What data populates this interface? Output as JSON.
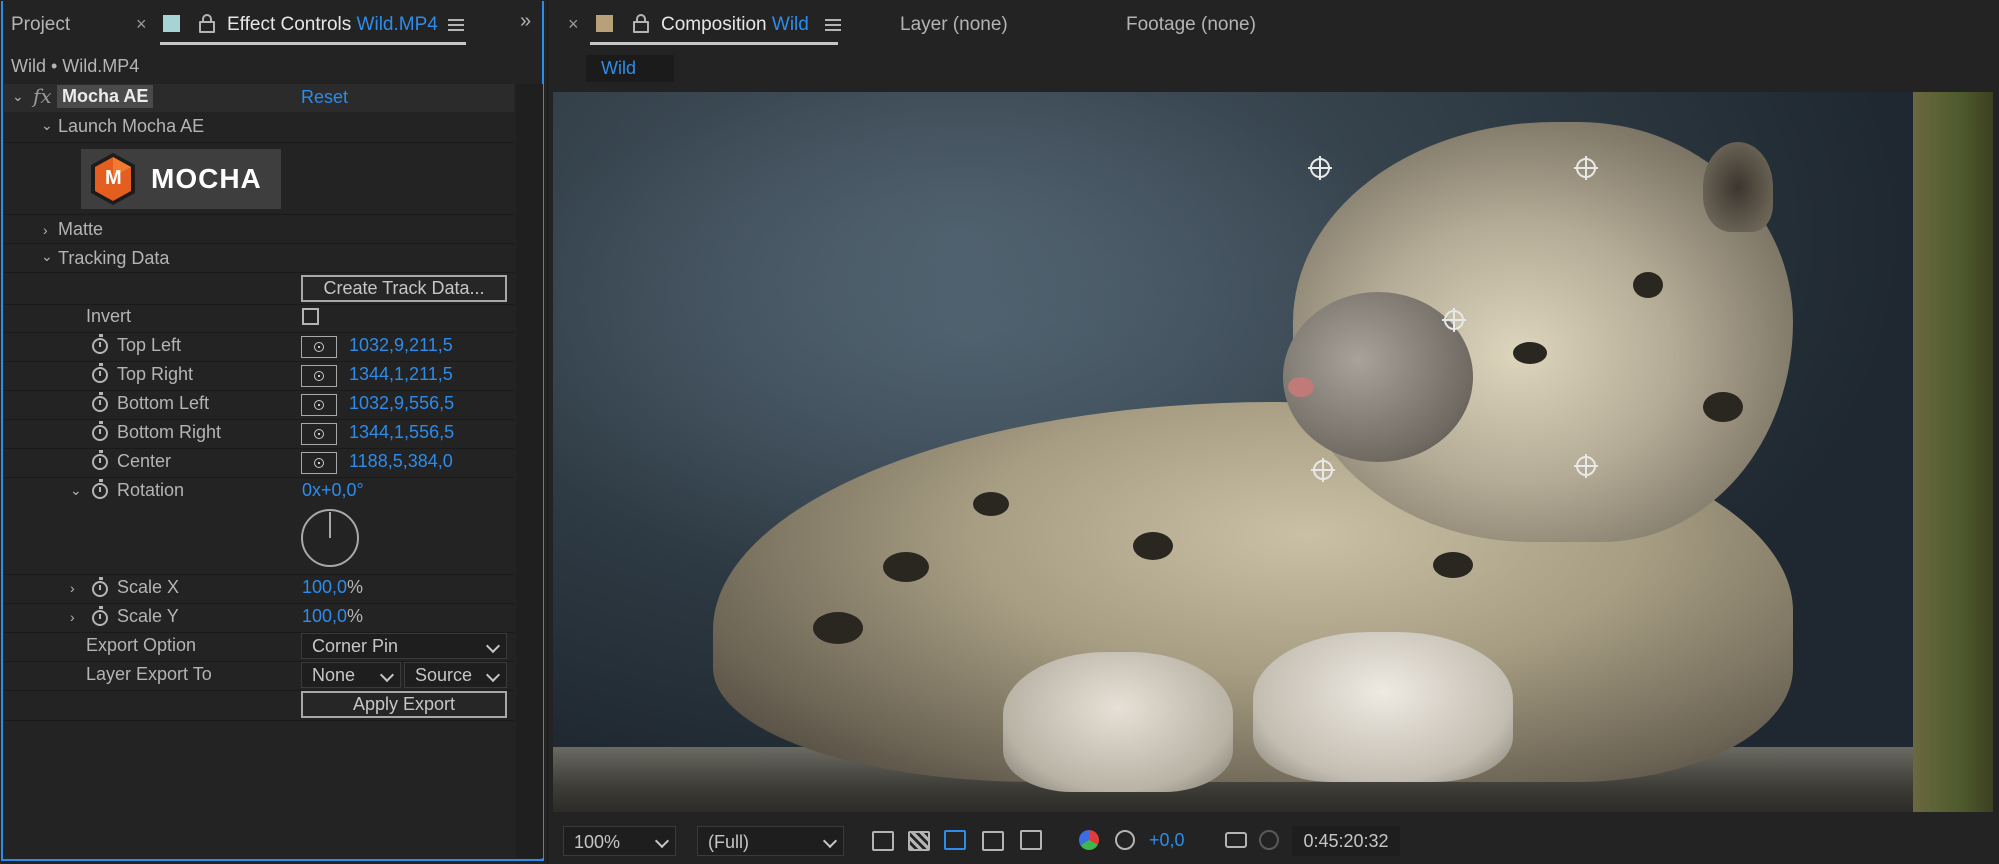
{
  "left_tabs": {
    "project": "Project",
    "close": "×",
    "effect_controls_prefix": "Effect Controls",
    "effect_controls_file": "Wild.MP4",
    "swatch_color": "#a8d3d4"
  },
  "header_path": "Wild • Wild.MP4",
  "effect": {
    "fx_glyph": "fx",
    "name": "Mocha AE",
    "reset": "Reset",
    "launch": "Launch Mocha AE",
    "logo_text": "MOCHA",
    "logo_letter": "M",
    "matte": "Matte",
    "tracking_data": "Tracking Data",
    "create_track_button": "Create Track Data...",
    "invert": "Invert",
    "params": [
      {
        "label": "Top Left",
        "value": "1032,9,211,5"
      },
      {
        "label": "Top Right",
        "value": "1344,1,211,5"
      },
      {
        "label": "Bottom Left",
        "value": "1032,9,556,5"
      },
      {
        "label": "Bottom Right",
        "value": "1344,1,556,5"
      },
      {
        "label": "Center",
        "value": "1188,5,384,0"
      }
    ],
    "rotation_label": "Rotation",
    "rotation_value": "0x+0,0°",
    "scale_x_label": "Scale X",
    "scale_x_value": "100,0",
    "scale_y_label": "Scale Y",
    "scale_y_value": "100,0",
    "percent": "%",
    "export_option_label": "Export Option",
    "export_option_value": "Corner Pin",
    "layer_export_label": "Layer Export To",
    "layer_export_value": "None",
    "layer_export_source": "Source",
    "apply_export_button": "Apply Export"
  },
  "right_tabs": {
    "close": "×",
    "composition_prefix": "Composition",
    "composition_name": "Wild",
    "layer": "Layer (none)",
    "footage": "Footage (none)",
    "swatch_color": "#b7a07a",
    "sub_tab": "Wild"
  },
  "viewer_footer": {
    "zoom": "100%",
    "resolution": "(Full)",
    "exposure": "+0,0",
    "timecode": "0:45:20:32"
  }
}
